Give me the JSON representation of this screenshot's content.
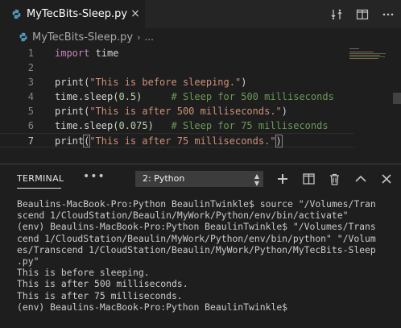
{
  "tab": {
    "title": "MyTecBits-Sleep.py",
    "close_glyph": "×"
  },
  "editor_actions": [
    "open-changes-icon",
    "split-editor-icon",
    "more-actions-icon"
  ],
  "breadcrumb": {
    "file": "MyTecBits-Sleep.py",
    "more": "..."
  },
  "editor": {
    "lines": [
      {
        "n": "1",
        "tokens": [
          [
            "kw",
            "import"
          ],
          [
            "",
            ""
          ],
          [
            "plain",
            " time"
          ]
        ]
      },
      {
        "n": "2",
        "tokens": []
      },
      {
        "n": "3",
        "tokens": [
          [
            "plain",
            "print("
          ],
          [
            "str",
            "\"This is before sleeping.\""
          ],
          [
            "plain",
            ")"
          ]
        ]
      },
      {
        "n": "4",
        "tokens": [
          [
            "plain",
            "time.sleep("
          ],
          [
            "num",
            "0.5"
          ],
          [
            "plain",
            ")     "
          ],
          [
            "cmt",
            "# Sleep for 500 milliseconds"
          ]
        ]
      },
      {
        "n": "5",
        "tokens": [
          [
            "plain",
            "print("
          ],
          [
            "str",
            "\"This is after 500 milliseconds.\""
          ],
          [
            "plain",
            ")"
          ]
        ]
      },
      {
        "n": "6",
        "tokens": [
          [
            "plain",
            "time.sleep("
          ],
          [
            "num",
            "0.075"
          ],
          [
            "plain",
            ")   "
          ],
          [
            "cmt",
            "# Sleep for 75 milliseconds"
          ]
        ]
      },
      {
        "n": "7",
        "tokens": [
          [
            "plain",
            "print"
          ],
          [
            "bracket",
            "("
          ],
          [
            "str",
            "\"This is after 75 milliseconds.\""
          ],
          [
            "bracket",
            ")"
          ]
        ]
      }
    ],
    "current_line": "7"
  },
  "panel": {
    "tab": "TERMINAL",
    "more": "•••",
    "shell_select": "2: Python",
    "actions": [
      "new-terminal-icon",
      "split-terminal-icon",
      "kill-terminal-icon",
      "maximize-panel-icon",
      "close-panel-icon"
    ]
  },
  "terminal": {
    "lines": [
      "Beaulins-MacBook-Pro:Python BeaulinTwinkle$ source \"/Volumes/Tran",
      "scend 1/CloudStation/Beaulin/MyWork/Python/env/bin/activate\"",
      "(env) Beaulins-MacBook-Pro:Python BeaulinTwinkle$ \"/Volumes/Trans",
      "cend 1/CloudStation/Beaulin/MyWork/Python/env/bin/python\" \"/Volum",
      "es/Transcend 1/CloudStation/Beaulin/MyWork/Python/MyTecBits-Sleep",
      ".py\"",
      "This is before sleeping.",
      "This is after 500 milliseconds.",
      "This is after 75 milliseconds.",
      "(env) Beaulins-MacBook-Pro:Python BeaulinTwinkle$ "
    ]
  },
  "colors": {
    "background": "#1e1e1e",
    "keyword": "#c586c0",
    "string": "#ce9178",
    "number": "#b5cea8",
    "comment": "#6a9955"
  }
}
